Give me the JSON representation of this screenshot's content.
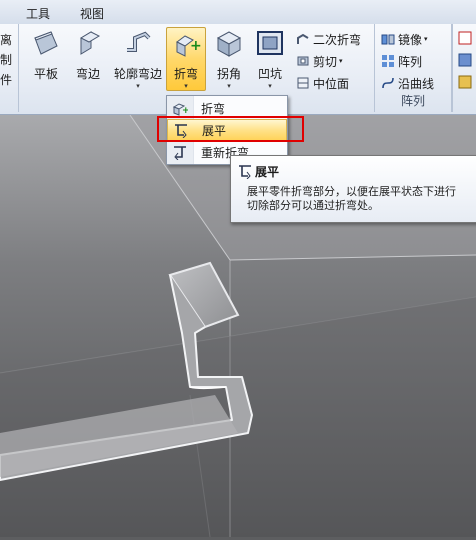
{
  "tabs": [
    "工具",
    "视图"
  ],
  "left_cut_labels": [
    "离",
    "制",
    "件"
  ],
  "ribbon": {
    "big_buttons": [
      {
        "label": "平板",
        "has_arrow": false
      },
      {
        "label": "弯边",
        "has_arrow": false
      },
      {
        "label": "轮廓弯边",
        "has_arrow": true
      },
      {
        "label": "折弯",
        "has_arrow": true,
        "active": true
      },
      {
        "label": "拐角",
        "has_arrow": true
      },
      {
        "label": "凹坑",
        "has_arrow": true
      }
    ],
    "small_buttons": [
      {
        "label": "二次折弯"
      },
      {
        "label": "剪切",
        "has_arrow": true
      },
      {
        "label": "中位面"
      }
    ],
    "array_group": {
      "items": [
        {
          "label": "镜像",
          "has_arrow": true
        },
        {
          "label": "阵列"
        },
        {
          "label": "沿曲线"
        }
      ],
      "group_label": "阵列"
    },
    "arrow_glyph": "▾"
  },
  "menu": {
    "items": [
      {
        "label": "折弯",
        "highlighted": false
      },
      {
        "label": "展平",
        "highlighted": true
      },
      {
        "label": "重新折弯",
        "highlighted": false
      }
    ]
  },
  "tooltip": {
    "title": "展平",
    "body": "展平零件折弯部分，以便在展平状态下进行\n切除部分可以通过折弯处。"
  },
  "colors": {
    "accent_active": "#ffd86b",
    "highlight_border": "#e00000",
    "viewport_bg": "#5d5e60"
  }
}
